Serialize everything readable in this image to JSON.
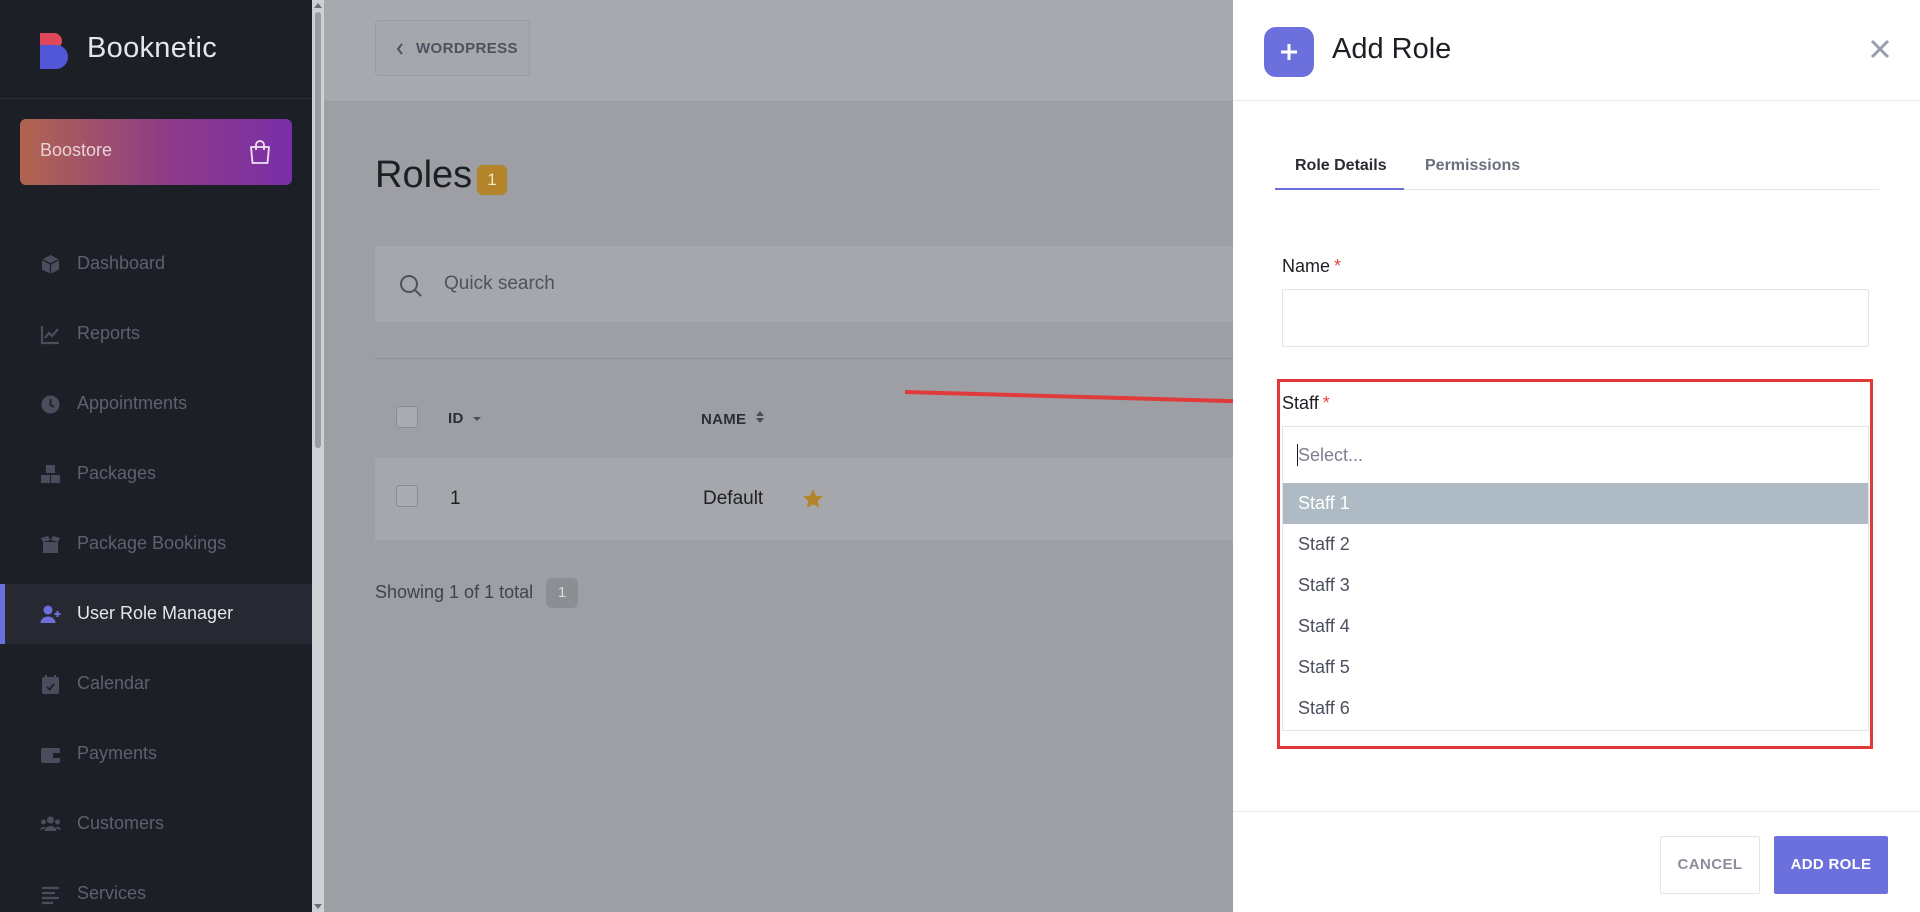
{
  "sidebar": {
    "brand": "Booknetic",
    "boostore_label": "Boostore",
    "items": [
      {
        "label": "Dashboard",
        "icon": "cube-icon"
      },
      {
        "label": "Reports",
        "icon": "chart-line-icon"
      },
      {
        "label": "Appointments",
        "icon": "clock-icon"
      },
      {
        "label": "Packages",
        "icon": "boxes-icon"
      },
      {
        "label": "Package Bookings",
        "icon": "box-open-icon"
      },
      {
        "label": "User Role Manager",
        "icon": "user-plus-icon",
        "active": true
      },
      {
        "label": "Calendar",
        "icon": "calendar-icon"
      },
      {
        "label": "Payments",
        "icon": "wallet-icon"
      },
      {
        "label": "Customers",
        "icon": "users-icon"
      },
      {
        "label": "Services",
        "icon": "list-icon"
      }
    ]
  },
  "main": {
    "back_label": "WORDPRESS",
    "title": "Roles",
    "count": "1",
    "search_placeholder": "Quick search",
    "table": {
      "headers": {
        "id": "ID",
        "name": "NAME"
      },
      "rows": [
        {
          "id": "1",
          "name": "Default",
          "is_default": true
        }
      ]
    },
    "showing": "Showing 1 of 1 total",
    "page": "1"
  },
  "panel": {
    "title": "Add Role",
    "tabs": [
      {
        "label": "Role Details",
        "active": true
      },
      {
        "label": "Permissions",
        "active": false
      }
    ],
    "name_label": "Name",
    "name_value": "",
    "staff_label": "Staff",
    "required_mark": "*",
    "staff_search_placeholder": "Select...",
    "staff_options": [
      "Staff 1",
      "Staff 2",
      "Staff 3",
      "Staff 4",
      "Staff 5",
      "Staff 6"
    ],
    "highlighted_option": "Staff 1",
    "cancel_label": "CANCEL",
    "submit_label": "ADD ROLE"
  },
  "colors": {
    "accent": "#6c70dc",
    "annotation": "#e03a3a",
    "sidebar_bg": "#1d1f27",
    "badge": "#b4842a"
  }
}
